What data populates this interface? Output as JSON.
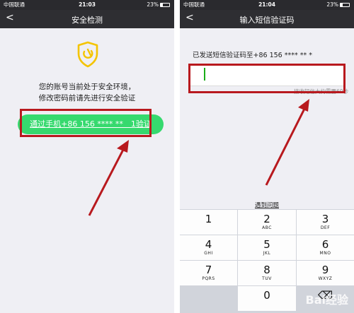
{
  "left_screen": {
    "status": {
      "carrier": "中国联通",
      "time": "21:03",
      "battery": "23%"
    },
    "nav": {
      "back_glyph": "<",
      "title": "安全检测"
    },
    "notice_line1": "您的账号当前处于安全环境，",
    "notice_line2": "修改密码前请先进行安全验证",
    "verify_button": "通过手机+86 156 **** **　1验证",
    "icon": "shield-icon",
    "accent_color": "#36d96e"
  },
  "right_screen": {
    "status": {
      "carrier": "中国联通",
      "time": "21:04",
      "battery": "23%"
    },
    "nav": {
      "back_glyph": "<",
      "title": "输入短信验证码"
    },
    "sent_tip": "已发送短信验证码至+86 156 **** ** *",
    "code_value": "",
    "resend_tip": "接收短信大约需要60秒",
    "problem_link": "遇到问题",
    "keypad": [
      [
        {
          "num": "1",
          "letters": ""
        },
        {
          "num": "2",
          "letters": "ABC"
        },
        {
          "num": "3",
          "letters": "DEF"
        }
      ],
      [
        {
          "num": "4",
          "letters": "GHI"
        },
        {
          "num": "5",
          "letters": "JKL"
        },
        {
          "num": "6",
          "letters": "MNO"
        }
      ],
      [
        {
          "num": "7",
          "letters": "PQRS"
        },
        {
          "num": "8",
          "letters": "TUV"
        },
        {
          "num": "9",
          "letters": "WXYZ"
        }
      ],
      [
        {
          "num": "",
          "letters": ""
        },
        {
          "num": "0",
          "letters": ""
        },
        {
          "num": "⌫",
          "letters": ""
        }
      ]
    ]
  },
  "annotation_color": "#b8191e",
  "watermark": "Bai经验"
}
